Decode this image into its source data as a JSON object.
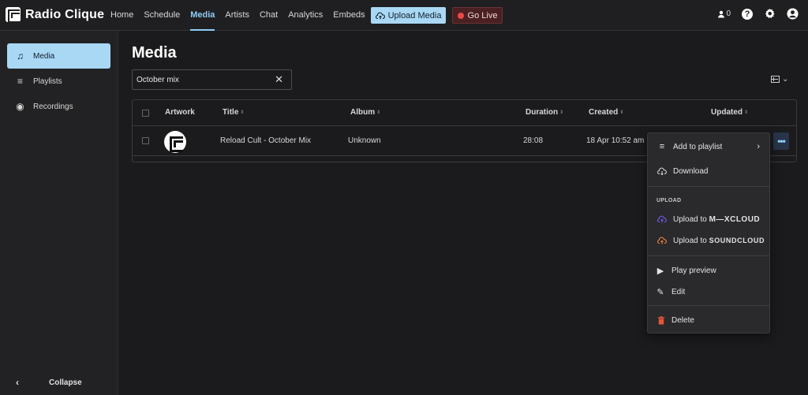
{
  "app": {
    "name": "Radio Clique"
  },
  "nav": {
    "items": [
      {
        "label": "Home"
      },
      {
        "label": "Schedule"
      },
      {
        "label": "Media"
      },
      {
        "label": "Artists"
      },
      {
        "label": "Chat"
      },
      {
        "label": "Analytics"
      },
      {
        "label": "Embeds"
      }
    ],
    "active": "Media",
    "upload_label": "Upload Media",
    "golive_label": "Go Live",
    "listener_count": "0"
  },
  "sidebar": {
    "items": [
      {
        "label": "Media",
        "icon": "music-note-icon",
        "active": true
      },
      {
        "label": "Playlists",
        "icon": "playlist-icon",
        "active": false
      },
      {
        "label": "Recordings",
        "icon": "record-icon",
        "active": false
      }
    ],
    "collapse_label": "Collapse"
  },
  "main": {
    "title": "Media",
    "search": {
      "value": "October mix",
      "placeholder": ""
    },
    "table": {
      "columns": [
        "Artwork",
        "Title",
        "Album",
        "Duration",
        "Created",
        "Updated"
      ],
      "rows": [
        {
          "title": "Reload Cult - October Mix",
          "album": "Unknown",
          "duration": "28:08",
          "created": "18 Apr 10:52 am",
          "updated": ""
        }
      ]
    }
  },
  "menu": {
    "add_to_playlist": "Add to playlist",
    "download": "Download",
    "upload_section": "UPLOAD",
    "upload_to": "Upload to",
    "mixcloud": "M—XCLOUD",
    "soundcloud": "SOUNDCLOUD",
    "play_preview": "Play preview",
    "edit": "Edit",
    "delete": "Delete"
  },
  "colors": {
    "accent": "#8ecdf6",
    "upload_bg": "#a9d8f5",
    "golive_bg": "#4a2022",
    "delete": "#e8553a",
    "mixcloud": "#6b5ce7",
    "soundcloud": "#e8833a"
  }
}
